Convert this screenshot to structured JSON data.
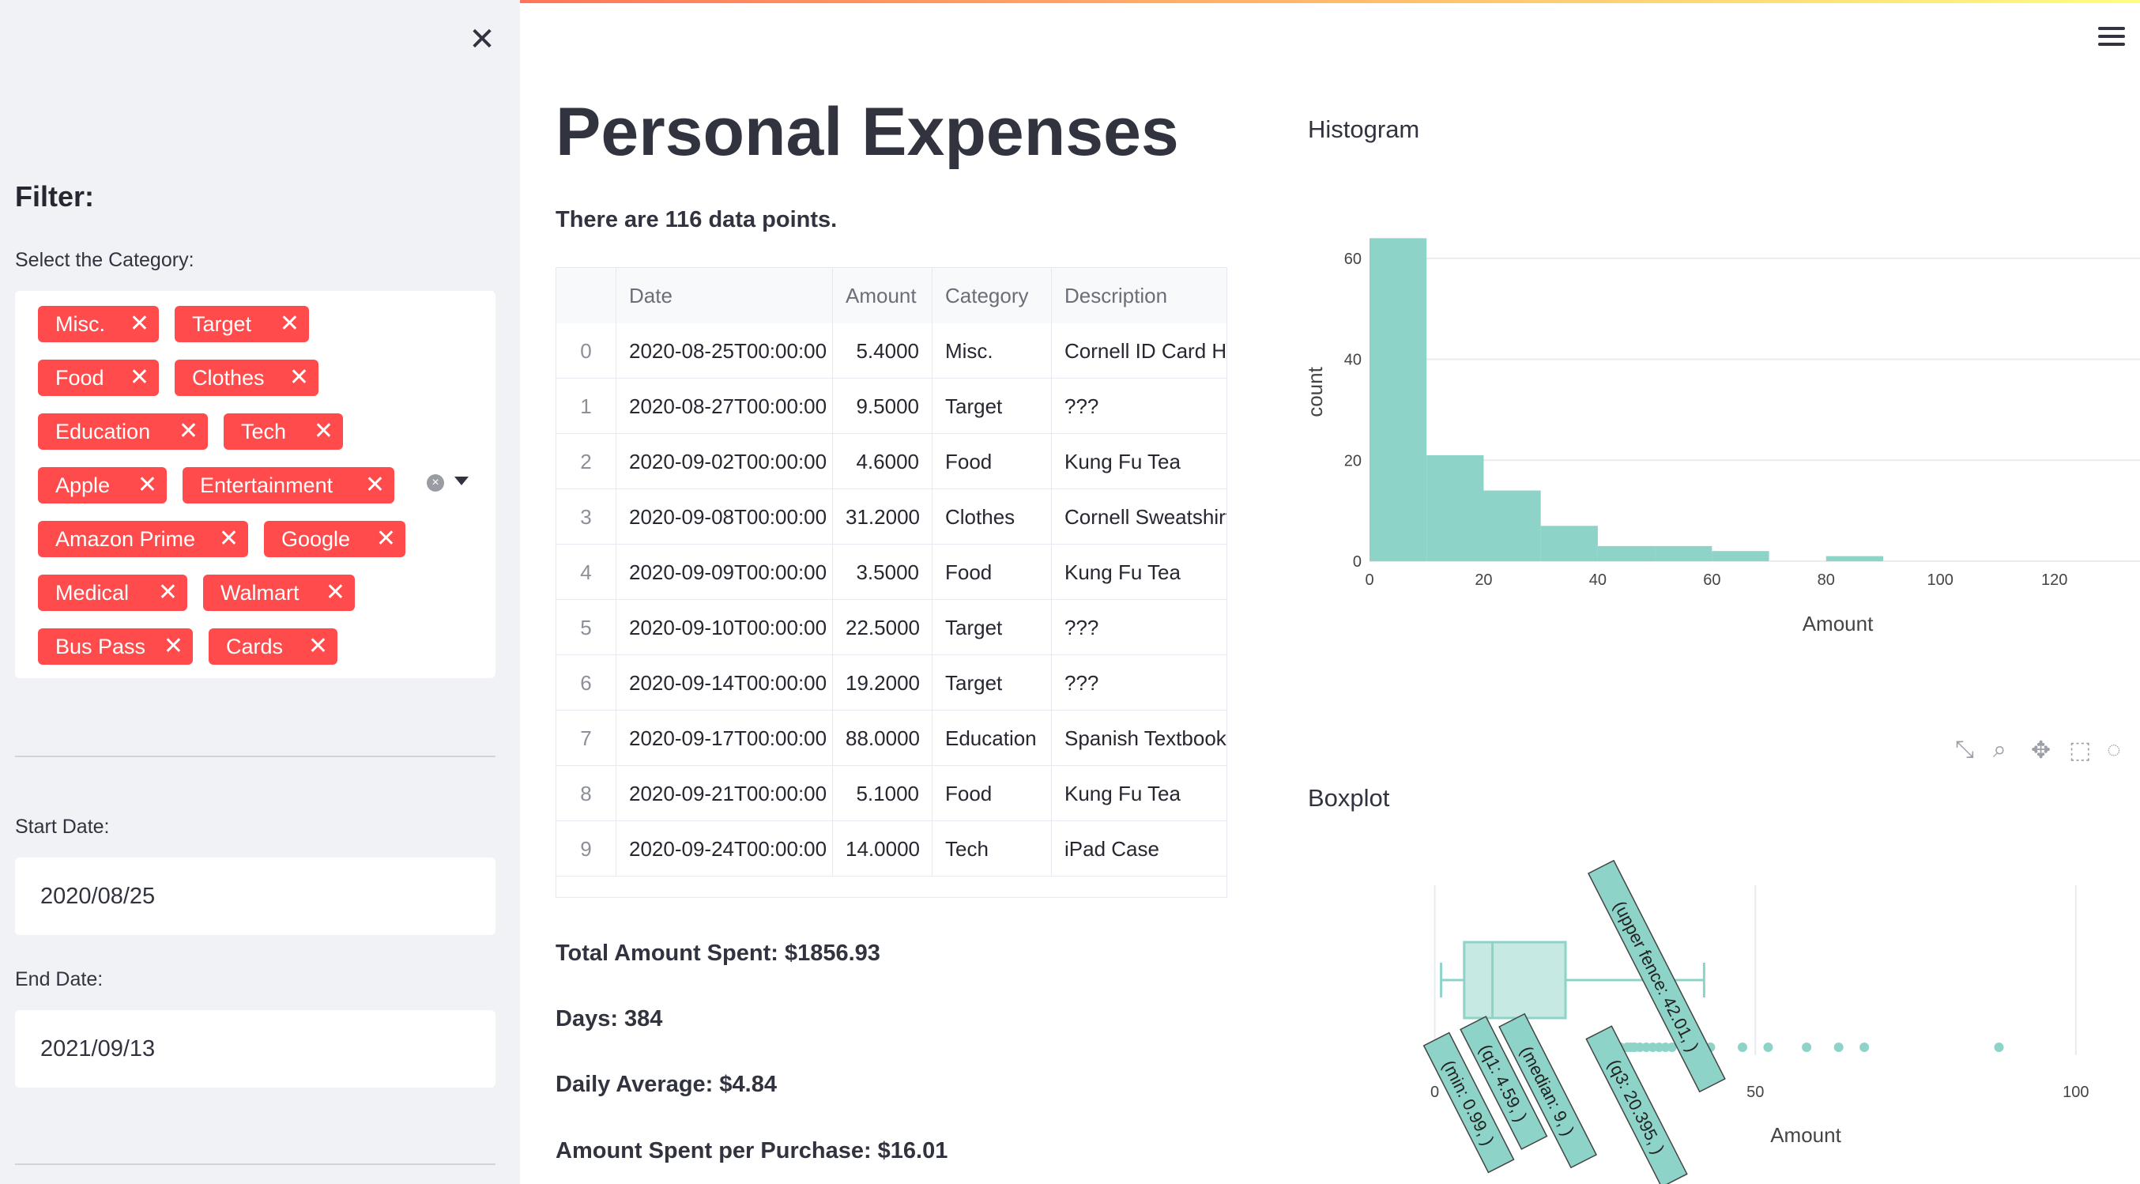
{
  "sidebar": {
    "close": "✕",
    "heading": "Filter:",
    "category_label": "Select the Category:",
    "categories": [
      "Misc.",
      "Target",
      "Food",
      "Clothes",
      "Education",
      "Tech",
      "Apple",
      "Entertainment",
      "Amazon Prime",
      "Google",
      "Medical",
      "Walmart",
      "Bus Pass",
      "Cards"
    ],
    "start_label": "Start Date:",
    "start_value": "2020/08/25",
    "end_label": "End Date:",
    "end_value": "2021/09/13"
  },
  "main": {
    "title": "Personal Expenses",
    "subtitle": "There are 116 data points.",
    "total": "Total Amount Spent: $1856.93",
    "days": "Days: 384",
    "daily": "Daily Average: $4.84",
    "per_purchase": "Amount Spent per Purchase: $16.01"
  },
  "table": {
    "columns": [
      "",
      "Date",
      "Amount",
      "Category",
      "Description"
    ],
    "rows": [
      [
        "0",
        "2020-08-25T00:00:00",
        "5.4000",
        "Misc.",
        "Cornell ID Card Holder"
      ],
      [
        "1",
        "2020-08-27T00:00:00",
        "9.5000",
        "Target",
        "???"
      ],
      [
        "2",
        "2020-09-02T00:00:00",
        "4.6000",
        "Food",
        "Kung Fu Tea"
      ],
      [
        "3",
        "2020-09-08T00:00:00",
        "31.2000",
        "Clothes",
        "Cornell Sweatshirt"
      ],
      [
        "4",
        "2020-09-09T00:00:00",
        "3.5000",
        "Food",
        "Kung Fu Tea"
      ],
      [
        "5",
        "2020-09-10T00:00:00",
        "22.5000",
        "Target",
        "???"
      ],
      [
        "6",
        "2020-09-14T00:00:00",
        "19.2000",
        "Target",
        "???"
      ],
      [
        "7",
        "2020-09-17T00:00:00",
        "88.0000",
        "Education",
        "Spanish Textbook"
      ],
      [
        "8",
        "2020-09-21T00:00:00",
        "5.1000",
        "Food",
        "Kung Fu Tea"
      ],
      [
        "9",
        "2020-09-24T00:00:00",
        "14.0000",
        "Tech",
        "iPad Case"
      ]
    ]
  },
  "chart_data": [
    {
      "type": "bar",
      "title": "Histogram",
      "xlabel": "Amount",
      "ylabel": "count",
      "color": "#8dd3c7",
      "bins": [
        [
          0,
          10
        ],
        [
          10,
          20
        ],
        [
          20,
          30
        ],
        [
          30,
          40
        ],
        [
          40,
          50
        ],
        [
          50,
          60
        ],
        [
          60,
          70
        ],
        [
          70,
          80
        ],
        [
          80,
          90
        ]
      ],
      "values": [
        64,
        21,
        14,
        7,
        3,
        3,
        2,
        0,
        1
      ],
      "xlim": [
        0,
        135
      ],
      "ylim": [
        0,
        65
      ],
      "xticks": [
        0,
        20,
        40,
        60,
        80,
        100,
        120
      ],
      "yticks": [
        0,
        20,
        40,
        60
      ]
    },
    {
      "type": "box",
      "title": "Boxplot",
      "xlabel": "Amount",
      "color": "#8dd3c7",
      "min": 0.99,
      "q1": 4.59,
      "median": 9,
      "q3": 20.395,
      "upper_fence": 42.01,
      "xlim": [
        -5,
        110
      ],
      "xticks": [
        0,
        50,
        100
      ],
      "outliers": [
        28,
        29,
        30,
        30.5,
        31,
        31.2,
        32,
        33,
        34,
        35,
        36,
        37,
        40,
        41,
        43,
        48,
        52,
        58,
        63,
        67,
        88
      ],
      "labels": [
        "(min: 0.99, )",
        "(q1: 4.59, )",
        "(median: 9, )",
        "(q3: 20.395, )",
        "(upper fence: 42.01, )"
      ]
    }
  ]
}
